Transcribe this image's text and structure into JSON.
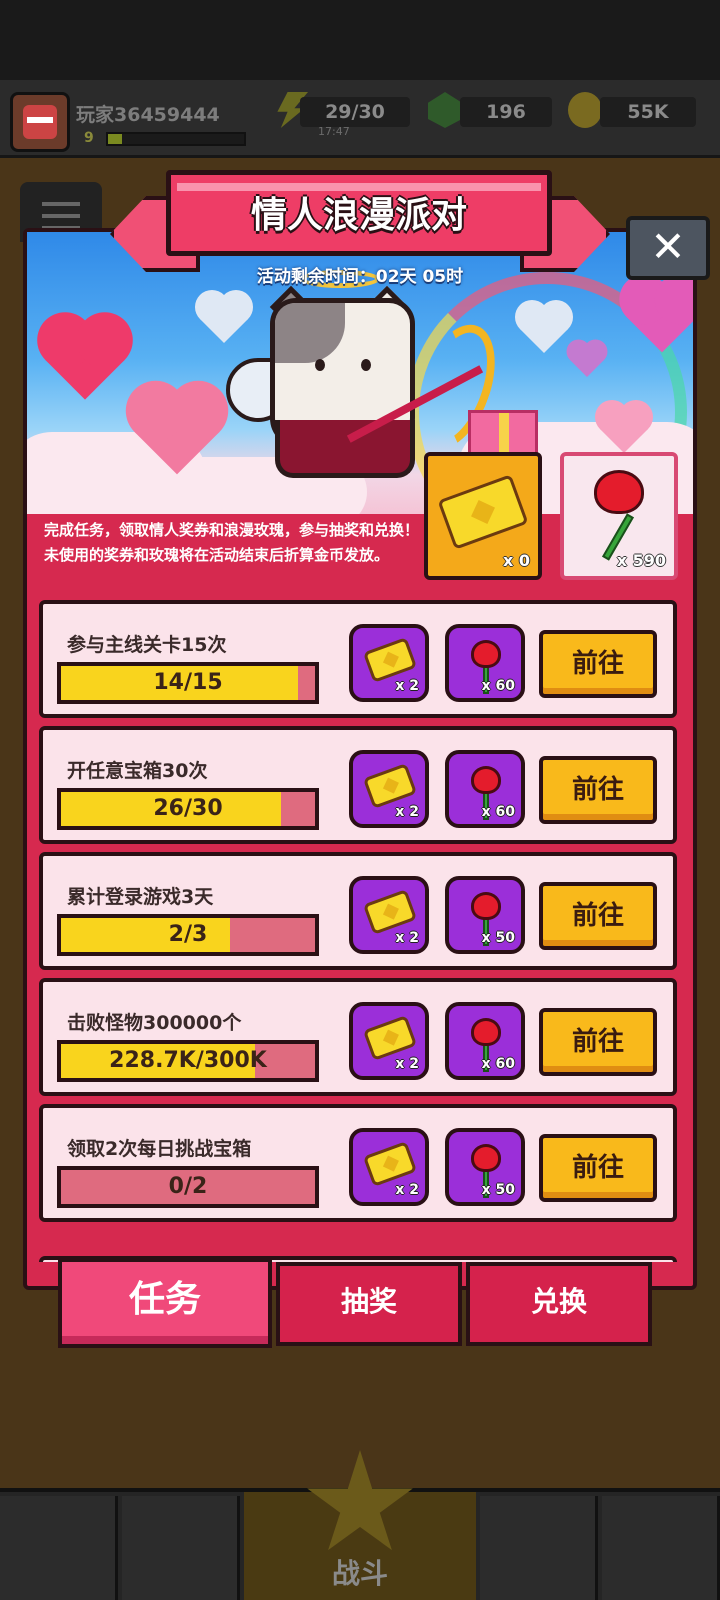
{
  "hud": {
    "player_name": "玩家36459444",
    "player_level": "9",
    "energy": "29/30",
    "energy_timer": "17:47",
    "gems": "196",
    "coins": "55K"
  },
  "event": {
    "title": "情人浪漫派对",
    "time_remaining": "活动剩余时间：02天 05时",
    "description": "完成任务，领取情人奖券和浪漫玫瑰，参与抽奖和兑换！未使用的奖券和玫瑰将在活动结束后折算金币发放。",
    "ticket_count": "x 0",
    "rose_count": "x 590",
    "close_icon": "✕"
  },
  "tasks": [
    {
      "name": "参与主线关卡15次",
      "progress_text": "14/15",
      "progress": 0.933,
      "ticket_reward": "x 2",
      "rose_reward": "x 60",
      "button": "前往"
    },
    {
      "name": "开任意宝箱30次",
      "progress_text": "26/30",
      "progress": 0.867,
      "ticket_reward": "x 2",
      "rose_reward": "x 60",
      "button": "前往"
    },
    {
      "name": "累计登录游戏3天",
      "progress_text": "2/3",
      "progress": 0.667,
      "ticket_reward": "x 2",
      "rose_reward": "x 50",
      "button": "前往"
    },
    {
      "name": "击败怪物300000个",
      "progress_text": "228.7K/300K",
      "progress": 0.762,
      "ticket_reward": "x 2",
      "rose_reward": "x 60",
      "button": "前往"
    },
    {
      "name": "领取2次每日挑战宝箱",
      "progress_text": "0/2",
      "progress": 0,
      "ticket_reward": "x 2",
      "rose_reward": "x 50",
      "button": "前往"
    }
  ],
  "tabs": {
    "tasks": "任务",
    "draw": "抽奖",
    "exchange": "兑换"
  },
  "bottom_nav": {
    "battle": "战斗"
  },
  "colors": {
    "modal": "#d6294f",
    "button": "#f9b91b",
    "reward_bg": "#9b2fd9",
    "progress_fill": "#f9d41d"
  }
}
